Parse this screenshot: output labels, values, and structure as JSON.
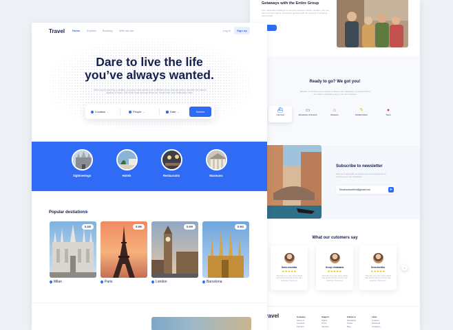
{
  "left": {
    "nav": {
      "logo": "Travel",
      "links": [
        "Home",
        "Explore",
        "Booking",
        "Who we are"
      ],
      "login": "Log in",
      "signup": "Sign up"
    },
    "hero": {
      "title_line1": "Dare to live the life",
      "title_line2": "you’ve always wanted.",
      "subtitle": "When you're planning a vacation, you may come across a lot of different terms that are used to describe the various aspects of travel. One of the most common terms are \"travel rules\" and \"destination rules\"."
    },
    "search": {
      "location": "Location",
      "people": "People",
      "date": "Date",
      "button": "Search"
    },
    "categories": [
      "Sightseeings",
      "Hotels",
      "Restaurants",
      "Museums"
    ],
    "popular": {
      "title": "Popular destiations",
      "items": [
        {
          "city": "Milan",
          "price": "$ 235"
        },
        {
          "city": "Paris",
          "price": "$ 256"
        },
        {
          "city": "London",
          "price": "$ 209"
        },
        {
          "city": "Barcelona",
          "price": "$ 302"
        }
      ]
    }
  },
  "right": {
    "group": {
      "title": "Getaways with the Entire Group",
      "text": "Your destination buildings no resource interest to family vacation, you can use to connect with a memorable getaway with the supports of amazing friend family."
    },
    "ready": {
      "title": "Ready to go? We got you!",
      "text": "Whether to it's that you're moving to travel to the Caribbean, or Liberty Places we make in getaway going to the next vacation.",
      "options": [
        {
          "label": "Carnival",
          "icon": "ship-icon"
        },
        {
          "label": "Attractions & Events",
          "icon": "ticket-icon"
        },
        {
          "label": "Museum",
          "icon": "museum-icon"
        },
        {
          "label": "Park&Culture",
          "icon": "park-icon"
        },
        {
          "label": "Tours",
          "icon": "map-pin-icon"
        }
      ]
    },
    "newsletter": {
      "title": "Subscribe to newsletter",
      "text": "Stay up to date with our latest news and promotions by signing up for our newsletter",
      "email": "Email.subscribed@gmail.com"
    },
    "testimonials": {
      "title": "What our cutomers say",
      "items": [
        {
          "name": "Daria chezbika",
          "stars": "★★★★★",
          "text": "The hotel is so nice. Every detail was perfect and the service was amazing. Thank you!"
        },
        {
          "name": "Group chatabaria",
          "stars": "★★★★★",
          "text": "The hotel is so nice. Every detail was perfect and the service was amazing. Thank you!"
        },
        {
          "name": "Sena durdiko",
          "stars": "★★★★★",
          "text": "The hotel is so nice. Every detail was perfect and the service was amazing. Thank you!"
        }
      ]
    },
    "footer": {
      "logo": "Travel",
      "cols": [
        [
          "Company",
          "About us",
          "Contacts",
          "Partners",
          "Press"
        ],
        [
          "Support",
          "Flights",
          "Terms",
          "Sitemap",
          "Returns"
        ],
        [
          "Follow us",
          "Newsletter",
          "Twitter",
          "Blog"
        ],
        [
          "Links",
          "Linkedin",
          "Facebook",
          "Instagram",
          "Twitter"
        ]
      ]
    }
  },
  "colors": {
    "accent": "#2f6bf5",
    "ink": "#16204a",
    "muted": "#a3aabd",
    "star": "#f5b400"
  }
}
